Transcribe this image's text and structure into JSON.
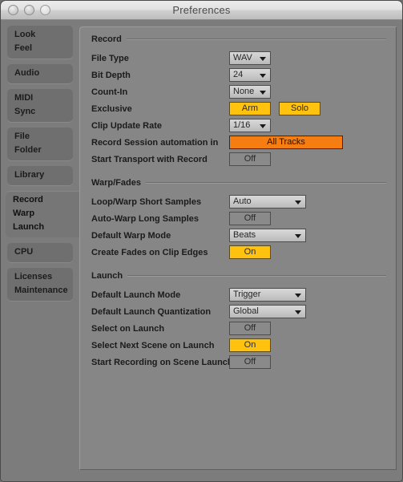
{
  "window": {
    "title": "Preferences",
    "traffic_lights": [
      "close-button",
      "minimize-button",
      "zoom-button"
    ]
  },
  "sidebar": {
    "groups": [
      {
        "name": "look-feel",
        "selected": false,
        "items": [
          "Look",
          "Feel"
        ]
      },
      {
        "name": "audio",
        "selected": false,
        "items": [
          "Audio"
        ]
      },
      {
        "name": "midi-sync",
        "selected": false,
        "items": [
          "MIDI",
          "Sync"
        ]
      },
      {
        "name": "file-folder",
        "selected": false,
        "items": [
          "File",
          "Folder"
        ]
      },
      {
        "name": "library",
        "selected": false,
        "items": [
          "Library"
        ]
      },
      {
        "name": "record-warp-launch",
        "selected": true,
        "items": [
          "Record",
          "Warp",
          "Launch"
        ]
      },
      {
        "name": "cpu",
        "selected": false,
        "items": [
          "CPU"
        ]
      },
      {
        "name": "licenses-maintenance",
        "selected": false,
        "items": [
          "Licenses",
          "Maintenance"
        ]
      }
    ]
  },
  "sections": {
    "record": {
      "title": "Record",
      "rows": [
        {
          "label": "File Type",
          "control": "dropdown-small",
          "value": "WAV"
        },
        {
          "label": "Bit Depth",
          "control": "dropdown-small",
          "value": "24"
        },
        {
          "label": "Count-In",
          "control": "dropdown-small",
          "value": "None"
        },
        {
          "label": "Exclusive",
          "control": "toggle-pair",
          "value": "Arm",
          "value2": "Solo"
        },
        {
          "label": "Clip Update Rate",
          "control": "dropdown-small",
          "value": "1/16"
        },
        {
          "label": "Record Session automation in",
          "control": "toggle-wide-orange",
          "value": "All Tracks"
        },
        {
          "label": "Start Transport with Record",
          "control": "toggle",
          "value": "Off"
        }
      ]
    },
    "warp_fades": {
      "title": "Warp/Fades",
      "rows": [
        {
          "label": "Loop/Warp Short Samples",
          "control": "dropdown-large",
          "value": "Auto"
        },
        {
          "label": "Auto-Warp Long Samples",
          "control": "toggle",
          "value": "Off"
        },
        {
          "label": "Default Warp Mode",
          "control": "dropdown-large",
          "value": "Beats"
        },
        {
          "label": "Create Fades on Clip Edges",
          "control": "toggle-on",
          "value": "On"
        }
      ]
    },
    "launch": {
      "title": "Launch",
      "rows": [
        {
          "label": "Default Launch Mode",
          "control": "dropdown-large",
          "value": "Trigger"
        },
        {
          "label": "Default Launch Quantization",
          "control": "dropdown-large",
          "value": "Global"
        },
        {
          "label": "Select on Launch",
          "control": "toggle",
          "value": "Off"
        },
        {
          "label": "Select Next Scene on Launch",
          "control": "toggle-on",
          "value": "On"
        },
        {
          "label": "Start Recording on Scene Launch",
          "control": "toggle",
          "value": "Off"
        }
      ]
    }
  },
  "colors": {
    "accent_on": "#ffc20e",
    "accent_orange": "#f57d11",
    "panel_bg": "#868686",
    "sidebar_bg": "#7c7c7c"
  }
}
